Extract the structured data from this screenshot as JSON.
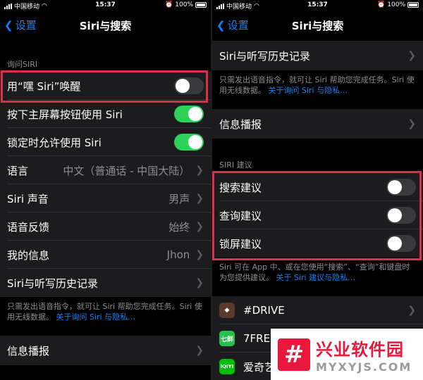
{
  "status_bar": {
    "carrier": "中国移动",
    "time": "15:37",
    "battery": "100%"
  },
  "left": {
    "nav": {
      "back_label": "设置",
      "title": "Siri与搜索"
    },
    "section_header": "询问SIRI",
    "rows": [
      {
        "label": "用“嘿 Siri”唤醒",
        "type": "toggle",
        "on": false
      },
      {
        "label": "按下主屏幕按钮使用 Siri",
        "type": "toggle",
        "on": true
      },
      {
        "label": "锁定时允许使用 Siri",
        "type": "toggle",
        "on": true
      },
      {
        "label": "语言",
        "type": "value",
        "value": "中文（普通话 - 中国大陆）"
      },
      {
        "label": "Siri 声音",
        "type": "value",
        "value": "男声"
      },
      {
        "label": "语音反馈",
        "type": "value",
        "value": "始终"
      },
      {
        "label": "我的信息",
        "type": "value",
        "value": "Jhon"
      },
      {
        "label": "Siri与听写历史记录",
        "type": "link"
      }
    ],
    "footnote": "只需发出语音指令，就可让 Siri 帮助您完成任务。Siri 使用无线数据。",
    "footnote_link": "关于询问 Siri 与隐私…",
    "announce_row": "信息播报"
  },
  "right": {
    "nav": {
      "back_label": "设置",
      "title": "Siri与搜索"
    },
    "history_row": "Siri与听写历史记录",
    "footnote": "只需发出语音指令，就可让 Siri 帮助您完成任务。Siri 使用无线数据。",
    "footnote_link": "关于询问 Siri 与隐私…",
    "announce_row": "信息播报",
    "section_header": "SIRI 建议",
    "suggestions": [
      {
        "label": "搜索建议",
        "on": false
      },
      {
        "label": "查询建议",
        "on": false
      },
      {
        "label": "锁屏建议",
        "on": false
      }
    ],
    "suggest_footnote": "Siri 可在 App 中、或在您使用“搜索”、“查询”和键盘时为您提供建议。",
    "suggest_footnote_link": "关于 Siri 建议与隐私…",
    "apps": [
      {
        "name": "#DRIVE",
        "icon": "drive-app-icon",
        "color": "#5b3a2a"
      },
      {
        "name": "7FRESH",
        "icon": "7fresh-app-icon",
        "icon_text": "七鲜",
        "color": "#27c24c"
      },
      {
        "name": "爱奇艺",
        "icon": "iqiyi-app-icon",
        "icon_text": "iQIYI",
        "color": "#00be06"
      }
    ]
  },
  "watermark": {
    "title": "兴业软件园",
    "subtitle": "MYXYJS.COM",
    "logo_glyph": "#"
  },
  "colors": {
    "accent": "#0a84ff",
    "toggle_on": "#30d158",
    "highlight": "#d9314a"
  }
}
